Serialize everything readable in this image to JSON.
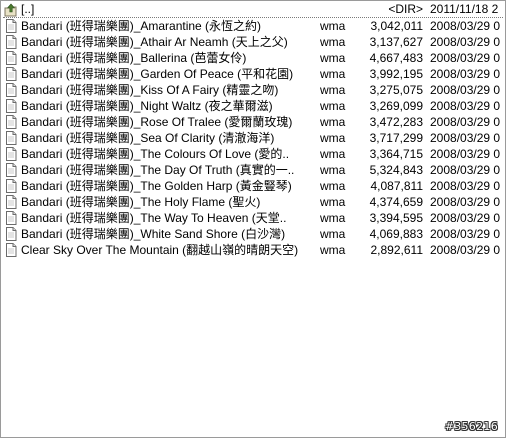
{
  "parent_row": {
    "name": "[..]",
    "ext": "",
    "size": "<DIR>",
    "date": "2011/11/18 2",
    "icon": "up-folder-icon"
  },
  "files": [
    {
      "name": "Bandari (班得瑞樂團)_Amarantine (永恆之約)",
      "ext": "wma",
      "size": "3,042,011",
      "date": "2008/03/29 0"
    },
    {
      "name": "Bandari (班得瑞樂團)_Athair Ar Neamh (天上之父)",
      "ext": "wma",
      "size": "3,137,627",
      "date": "2008/03/29 0"
    },
    {
      "name": "Bandari (班得瑞樂團)_Ballerina (芭蕾女伶)",
      "ext": "wma",
      "size": "4,667,483",
      "date": "2008/03/29 0"
    },
    {
      "name": "Bandari (班得瑞樂團)_Garden Of Peace (平和花園)",
      "ext": "wma",
      "size": "3,992,195",
      "date": "2008/03/29 0"
    },
    {
      "name": "Bandari (班得瑞樂團)_Kiss Of A Fairy (精靈之吻)",
      "ext": "wma",
      "size": "3,275,075",
      "date": "2008/03/29 0"
    },
    {
      "name": "Bandari (班得瑞樂團)_Night Waltz (夜之華爾滋)",
      "ext": "wma",
      "size": "3,269,099",
      "date": "2008/03/29 0"
    },
    {
      "name": "Bandari (班得瑞樂團)_Rose Of Tralee (愛爾蘭玫瑰)",
      "ext": "wma",
      "size": "3,472,283",
      "date": "2008/03/29 0"
    },
    {
      "name": "Bandari (班得瑞樂團)_Sea Of Clarity (清澈海洋)",
      "ext": "wma",
      "size": "3,717,299",
      "date": "2008/03/29 0"
    },
    {
      "name": "Bandari (班得瑞樂團)_The Colours Of Love (愛的..",
      "ext": "wma",
      "size": "3,364,715",
      "date": "2008/03/29 0"
    },
    {
      "name": "Bandari (班得瑞樂團)_The Day Of Truth (真實的一..",
      "ext": "wma",
      "size": "5,324,843",
      "date": "2008/03/29 0"
    },
    {
      "name": "Bandari (班得瑞樂團)_The Golden Harp (黃金豎琴)",
      "ext": "wma",
      "size": "4,087,811",
      "date": "2008/03/29 0"
    },
    {
      "name": "Bandari (班得瑞樂團)_The Holy Flame (聖火)",
      "ext": "wma",
      "size": "4,374,659",
      "date": "2008/03/29 0"
    },
    {
      "name": "Bandari (班得瑞樂團)_The Way To Heaven (天堂..",
      "ext": "wma",
      "size": "3,394,595",
      "date": "2008/03/29 0"
    },
    {
      "name": "Bandari (班得瑞樂團)_White Sand Shore (白沙灣)",
      "ext": "wma",
      "size": "4,069,883",
      "date": "2008/03/29 0"
    },
    {
      "name": "Clear Sky Over The Mountain (翻越山嶺的晴朗天空)",
      "ext": "wma",
      "size": "2,892,611",
      "date": "2008/03/29 0"
    }
  ],
  "file_icon": "file-icon",
  "watermark": "#356216"
}
